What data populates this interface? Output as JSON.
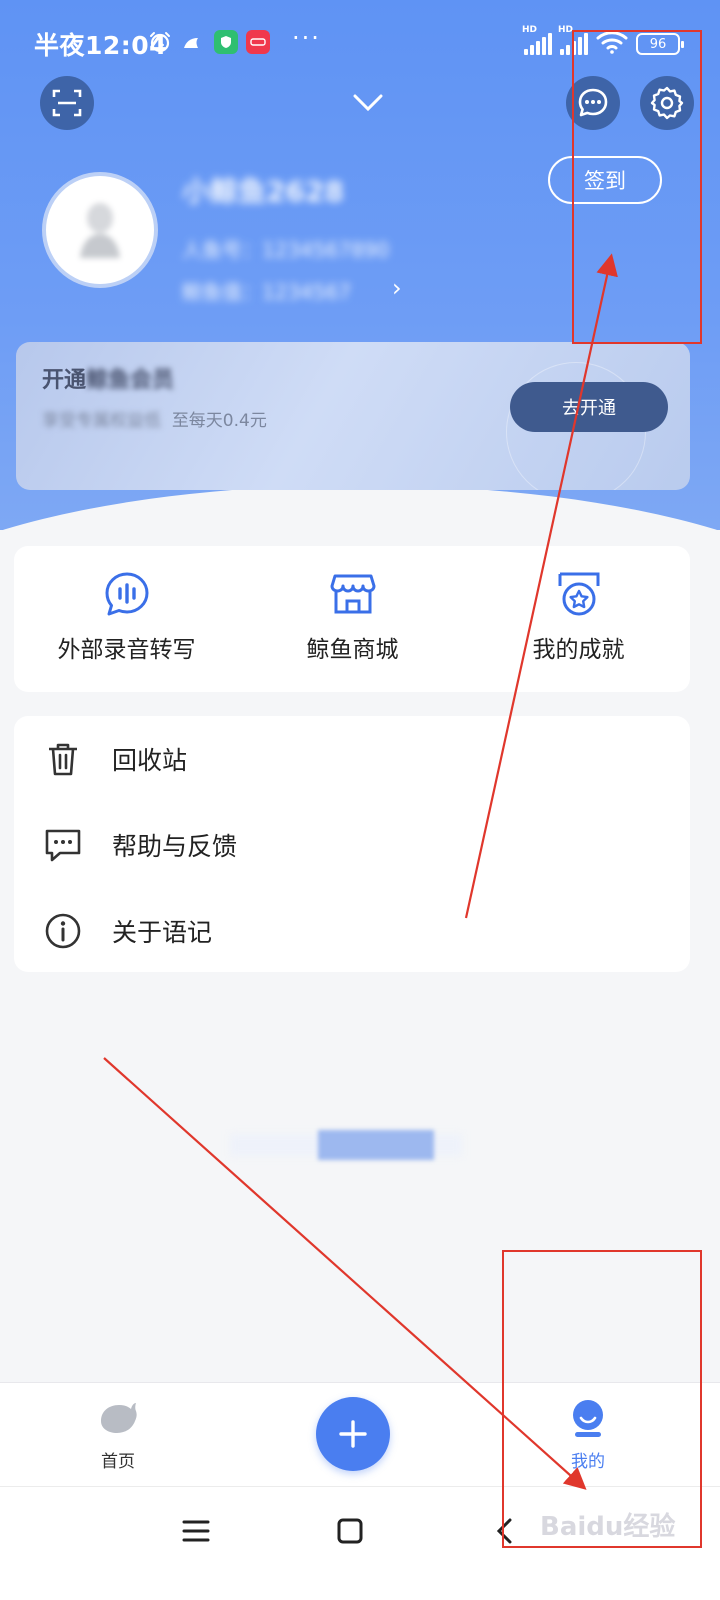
{
  "status_bar": {
    "time": "半夜12:04",
    "dots": "···",
    "battery": "96",
    "hd": "HD"
  },
  "header": {
    "user_name": "小鲸鱼2628",
    "info_line_1": "人鱼号：1234567890",
    "info_line_2": "鲸鱼值：1234567 ",
    "signin_label": "签到"
  },
  "vip_banner": {
    "title_prefix": "开通",
    "title_blurred": "鲸鱼会员",
    "subtitle_blurred": "享受专属权益低",
    "subtitle_suffix": "至每天0.4元",
    "button_label": "去开通"
  },
  "features": [
    {
      "label": "外部录音转写",
      "icon": "voice-transcribe-icon"
    },
    {
      "label": "鲸鱼商城",
      "icon": "store-icon"
    },
    {
      "label": "我的成就",
      "icon": "achievement-badge-icon"
    }
  ],
  "menu": [
    {
      "label": "回收站",
      "icon": "trash-icon"
    },
    {
      "label": "帮助与反馈",
      "icon": "chat-feedback-icon"
    },
    {
      "label": "关于语记",
      "icon": "info-icon"
    }
  ],
  "tabbar": {
    "home_label": "首页",
    "mine_label": "我的"
  },
  "watermark": "Baidu经验",
  "colors": {
    "primary": "#5f93f4",
    "accent_blue": "#4a7ef0",
    "vip_button": "#3f5a8e",
    "annotation_red": "#e0372c"
  }
}
